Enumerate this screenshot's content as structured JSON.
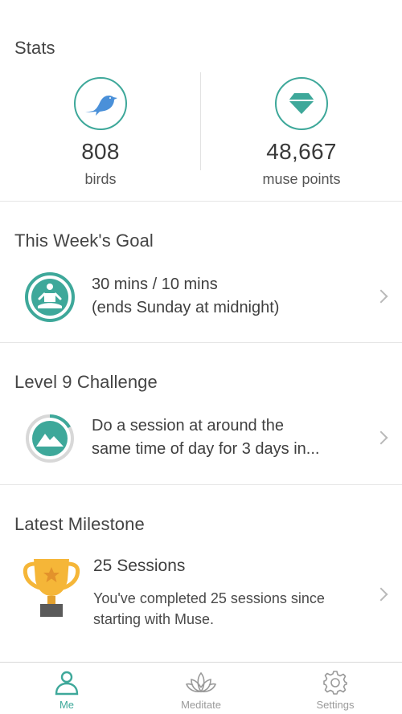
{
  "stats": {
    "title": "Stats",
    "birds": {
      "value": "808",
      "label": "birds",
      "icon": "bird-icon"
    },
    "points": {
      "value": "48,667",
      "label": "muse points",
      "icon": "diamond-icon"
    }
  },
  "goal": {
    "title": "This Week's Goal",
    "line1": "30 mins / 10 mins",
    "line2": "(ends Sunday at midnight)",
    "icon": "meditation-icon"
  },
  "challenge": {
    "title": "Level 9 Challenge",
    "line1": "Do a session at around the",
    "line2": "same time of day for 3 days in...",
    "icon": "mountain-progress-icon",
    "progress": 0.33
  },
  "milestone": {
    "title": "Latest Milestone",
    "name": "25 Sessions",
    "desc_line1": "You've completed 25 sessions since",
    "desc_line2": "starting with Muse.",
    "icon": "trophy-icon"
  },
  "tabs": [
    {
      "label": "Me",
      "icon": "person-icon",
      "active": true
    },
    {
      "label": "Meditate",
      "icon": "lotus-icon",
      "active": false
    },
    {
      "label": "Settings",
      "icon": "gear-icon",
      "active": false
    }
  ],
  "colors": {
    "accent": "#3ea89a",
    "bird_blue": "#4a90d9",
    "trophy_gold": "#f5b638",
    "text": "#3f3f3f"
  }
}
